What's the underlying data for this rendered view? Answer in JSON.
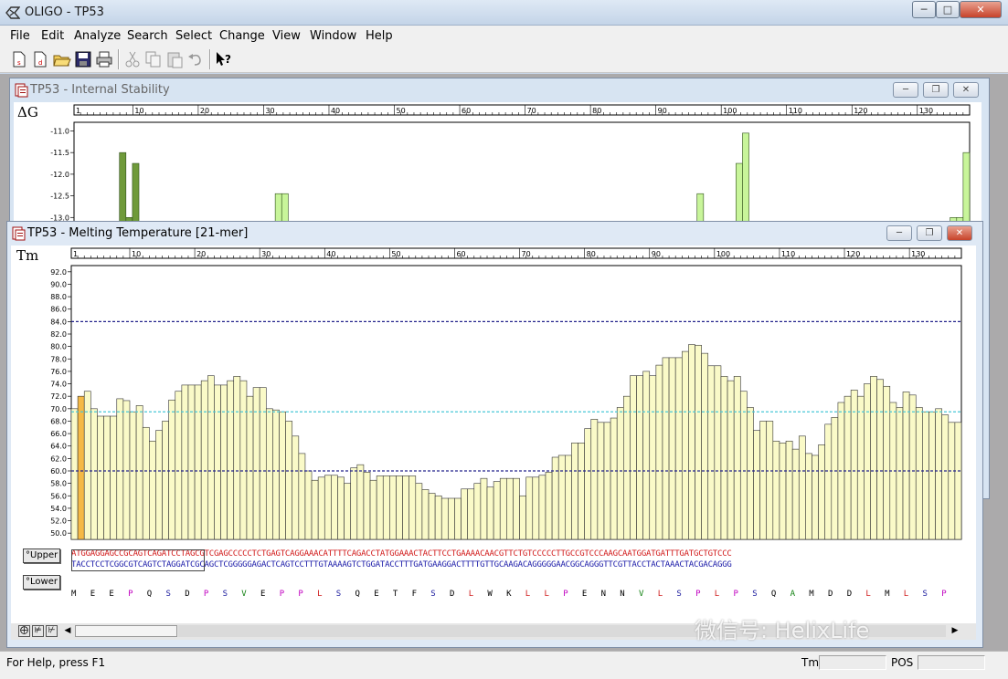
{
  "window": {
    "title": "OLIGO - TP53"
  },
  "menu": [
    "File",
    "Edit",
    "Analyze",
    "Search",
    "Select",
    "Change",
    "View",
    "Window",
    "Help"
  ],
  "toolbar": {
    "buttons": [
      "new-file-icon",
      "new-document-icon",
      "open-folder-icon",
      "save-icon",
      "print-icon",
      "cut-icon",
      "copy-icon",
      "paste-icon",
      "undo-icon",
      "context-help-icon"
    ]
  },
  "stability_window": {
    "title": "TP53 - Internal Stability",
    "axis_label": "ΔG",
    "ruler_ticks": [
      "1",
      "10",
      "20",
      "30",
      "40",
      "50",
      "60",
      "70",
      "80",
      "90",
      "100",
      "110",
      "120",
      "130"
    ],
    "y_ticks": [
      "-13.0",
      "-12.5",
      "-12.0",
      "-11.5",
      "-11.0"
    ]
  },
  "tm_window": {
    "title": "TP53 - Melting Temperature [21-mer]",
    "axis_label": "Tm",
    "ruler_ticks": [
      "1",
      "10",
      "20",
      "30",
      "40",
      "50",
      "60",
      "70",
      "80",
      "90",
      "100",
      "110",
      "120",
      "130"
    ],
    "upper_button": "Upper",
    "lower_button": "Lower",
    "sequence_top": "ATGGAGGAGCCGCAGTCAGATCCTAGCGTCGAGCCCCCTCTGAGTCAGGAAACATTTTCAGACCTATGGAAACTACTTCCTGAAAACAACGTTCTGTCCCCCTTGCCGTCCCAAGCAATGGATGATTTGATGCTGTCCC",
    "sequence_bottom": "TACCTCCTCGGCGTCAGTCTAGGATCGCAGCTCGGGGGAGACTCAGTCCTTTGTAAAAGTCTGGATACCTTTGATGAAGGACTTTTGTTGCAAGACAGGGGGAACGGCAGGGTTCGTTACCTACTAAACTACGACAGGG",
    "amino_acids": [
      "M",
      "E",
      "E",
      "P",
      "Q",
      "S",
      "D",
      "P",
      "S",
      "V",
      "E",
      "P",
      "P",
      "L",
      "S",
      "Q",
      "E",
      "T",
      "F",
      "S",
      "D",
      "L",
      "W",
      "K",
      "L",
      "L",
      "P",
      "E",
      "N",
      "N",
      "V",
      "L",
      "S",
      "P",
      "L",
      "P",
      "S",
      "Q",
      "A",
      "M",
      "D",
      "D",
      "L",
      "M",
      "L",
      "S",
      "P"
    ]
  },
  "status": {
    "help_text": "For Help, press F1",
    "tm_label": "Tm",
    "pos_label": "POS"
  },
  "watermark": "微信号: HelixLife",
  "colors": {
    "bar_fill": "#fafac8",
    "bar_highlight": "#f5b945",
    "stability_dark": "#6f9a3a",
    "stability_light": "#c8f59a",
    "upper_line": "#23238c",
    "mid_line": "#48c8d8",
    "lower_line": "#23238c"
  },
  "chart_data": [
    {
      "type": "bar",
      "title": "",
      "ylabel": "ΔG",
      "xlim": [
        1,
        138
      ],
      "ylim": [
        -13.5,
        -10.8
      ],
      "y_ticks": [
        -13.0,
        -12.5,
        -12.0,
        -11.5,
        -11.0
      ],
      "series": [
        {
          "x": [
            8,
            9,
            10
          ],
          "values": [
            -11.5,
            -13.0,
            -11.75
          ],
          "shade": "dark"
        },
        {
          "x": [
            32,
            33
          ],
          "values": [
            -12.45,
            -12.45
          ],
          "shade": "light"
        },
        {
          "x": [
            97,
            103,
            104
          ],
          "values": [
            -12.45,
            -11.75,
            -11.05
          ],
          "shade": "light"
        },
        {
          "x": [
            136,
            137,
            138
          ],
          "values": [
            -13.0,
            -13.0,
            -11.5
          ],
          "shade": "light"
        }
      ]
    },
    {
      "type": "bar",
      "title": "",
      "ylabel": "Tm",
      "xlim": [
        1,
        138
      ],
      "ylim": [
        49,
        93
      ],
      "y_ticks": [
        50.0,
        52.0,
        54.0,
        56.0,
        58.0,
        60.0,
        62.0,
        64.0,
        66.0,
        68.0,
        70.0,
        72.0,
        74.0,
        76.0,
        78.0,
        80.0,
        82.0,
        84.0,
        86.0,
        88.0,
        90.0,
        92.0
      ],
      "upper_limit": 84.0,
      "mid_line": 69.5,
      "lower_limit": 60.0,
      "highlight_index": 1,
      "values": [
        70.0,
        72.0,
        72.8,
        70.0,
        68.8,
        68.8,
        68.8,
        71.6,
        71.3,
        69.5,
        70.5,
        67.0,
        64.8,
        66.5,
        68.0,
        71.4,
        72.8,
        73.8,
        73.8,
        73.8,
        74.5,
        75.3,
        73.8,
        73.8,
        74.5,
        75.2,
        74.5,
        72.0,
        73.4,
        73.4,
        70.0,
        69.8,
        69.5,
        68.0,
        65.6,
        62.8,
        60.0,
        58.5,
        59.0,
        59.3,
        59.3,
        59.0,
        58.0,
        60.5,
        61.0,
        59.8,
        58.5,
        59.2,
        59.2,
        59.2,
        59.2,
        59.2,
        59.2,
        58.0,
        57.0,
        56.4,
        56.0,
        55.6,
        55.6,
        55.6,
        57.1,
        57.1,
        58.0,
        58.8,
        57.4,
        58.3,
        58.8,
        58.8,
        58.8,
        56.0,
        59.0,
        59.0,
        59.3,
        59.8,
        62.2,
        62.5,
        62.5,
        64.5,
        64.5,
        66.8,
        68.3,
        67.8,
        67.8,
        68.5,
        70.2,
        72.0,
        75.3,
        75.3,
        76.0,
        75.3,
        77.0,
        78.2,
        78.2,
        78.2,
        79.2,
        80.3,
        80.2,
        78.9,
        76.9,
        76.9,
        75.2,
        74.5,
        75.2,
        72.8,
        70.2,
        66.5,
        68.0,
        68.0,
        64.8,
        64.5,
        64.8,
        63.5,
        65.6,
        62.8,
        62.5,
        64.2,
        67.5,
        68.6,
        71.0,
        72.0,
        73.0,
        72.0,
        74.0,
        75.2,
        74.7,
        73.6,
        71.0,
        70.2,
        72.7,
        72.2,
        70.2,
        69.5,
        69.5,
        70.0,
        69.0,
        67.8,
        67.8
      ]
    }
  ]
}
